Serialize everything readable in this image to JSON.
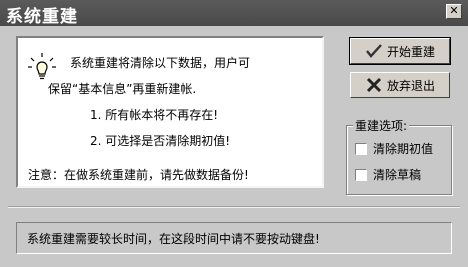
{
  "window": {
    "title": "系统重建",
    "close_icon": "close-icon"
  },
  "info": {
    "icon": "lightbulb-icon",
    "line1": "系统重建将清除以下数据，用户可",
    "line2": "保留“基本信息”再重新建帐.",
    "item1": "1.  所有帐本将不再存在!",
    "item2": "2.  可选择是否清除期初值!",
    "note": "注意：在做系统重建前，请先做数据备份!"
  },
  "buttons": {
    "start": {
      "label": "开始重建",
      "icon": "checkmark-icon"
    },
    "cancel": {
      "label": "放弃退出",
      "icon": "x-mark-icon"
    }
  },
  "options": {
    "label": "重建选项:",
    "clear_initial": {
      "label": "清除期初值",
      "checked": false
    },
    "clear_draft": {
      "label": "清除草稿",
      "checked": false
    }
  },
  "status": {
    "text": "系统重建需要较长时间，在这段时间中请不要按动键盘!"
  }
}
